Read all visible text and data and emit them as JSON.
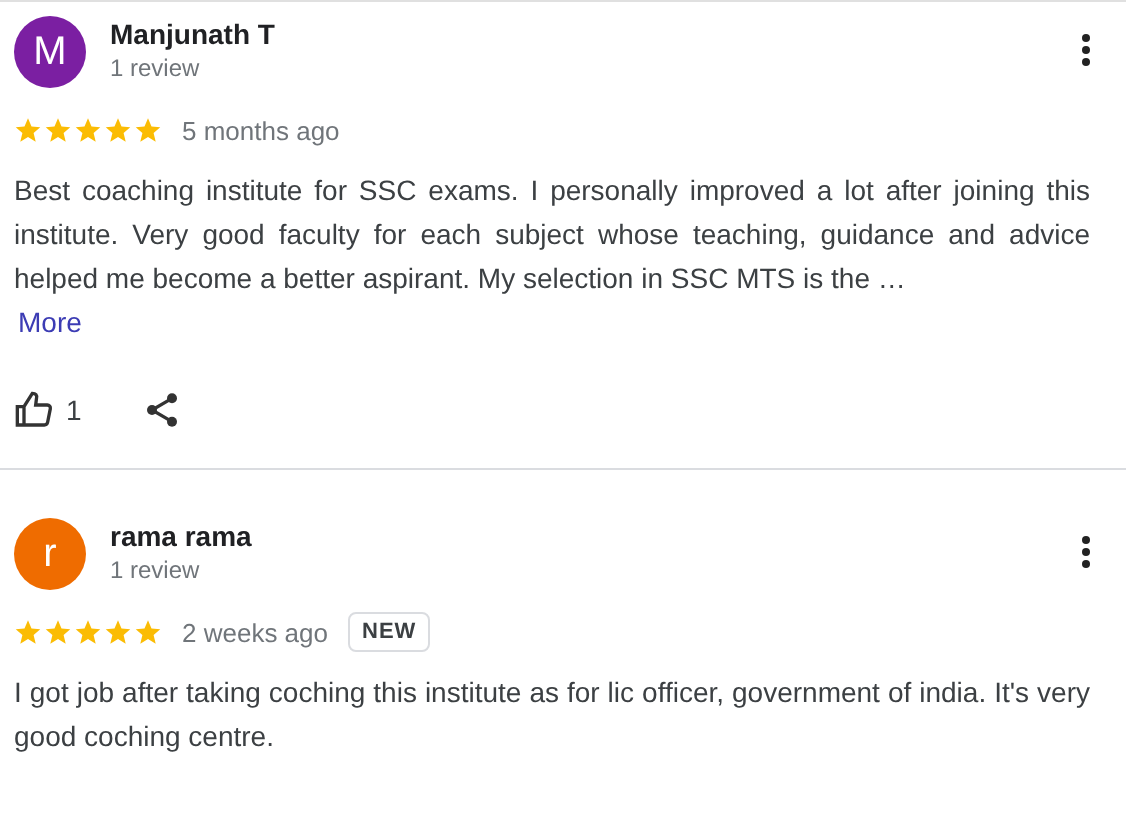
{
  "reviews": [
    {
      "avatar_letter": "M",
      "color": "#7b1fa2",
      "name": "Manjunath T",
      "review_count": "1 review",
      "stars": 5,
      "time": "5 months ago",
      "text": "Best coaching institute for SSC exams. I personally improved a lot after joining this institute. Very good faculty for each subject whose teaching, guidance and advice helped me become a better aspirant. My selection in SSC MTS is the …",
      "more": "More",
      "likes": "1"
    },
    {
      "avatar_letter": "r",
      "color": "#ef6c00",
      "name": "rama rama",
      "review_count": "1 review",
      "stars": 5,
      "time": "2 weeks ago",
      "badge": "NEW",
      "text": "I got job after taking coching this institute as for lic officer, government of india. It's very good coching centre."
    }
  ]
}
